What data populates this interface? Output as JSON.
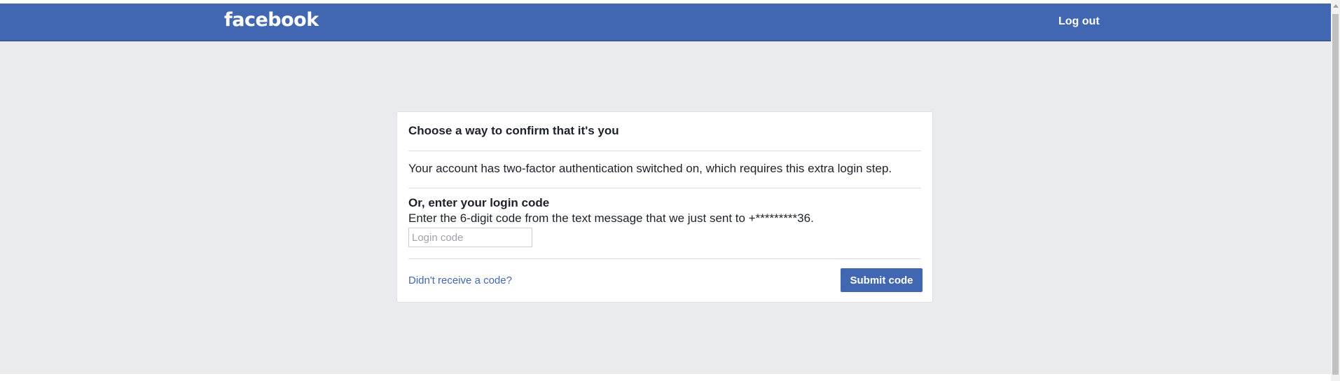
{
  "header": {
    "logo_text": "facebook",
    "logout_label": "Log out"
  },
  "card": {
    "title": "Choose a way to confirm that it's you",
    "info_text": "Your account has two-factor authentication switched on, which requires this extra login step.",
    "login_code_heading": "Or, enter your login code",
    "login_code_description": "Enter the 6-digit code from the text message that we just sent to +*********36.",
    "login_code_placeholder": "Login code",
    "login_code_value": "",
    "resend_link": "Didn't receive a code?",
    "submit_label": "Submit code"
  },
  "colors": {
    "brand": "#4267b2",
    "background": "#e9ebee",
    "text": "#1d2129"
  }
}
